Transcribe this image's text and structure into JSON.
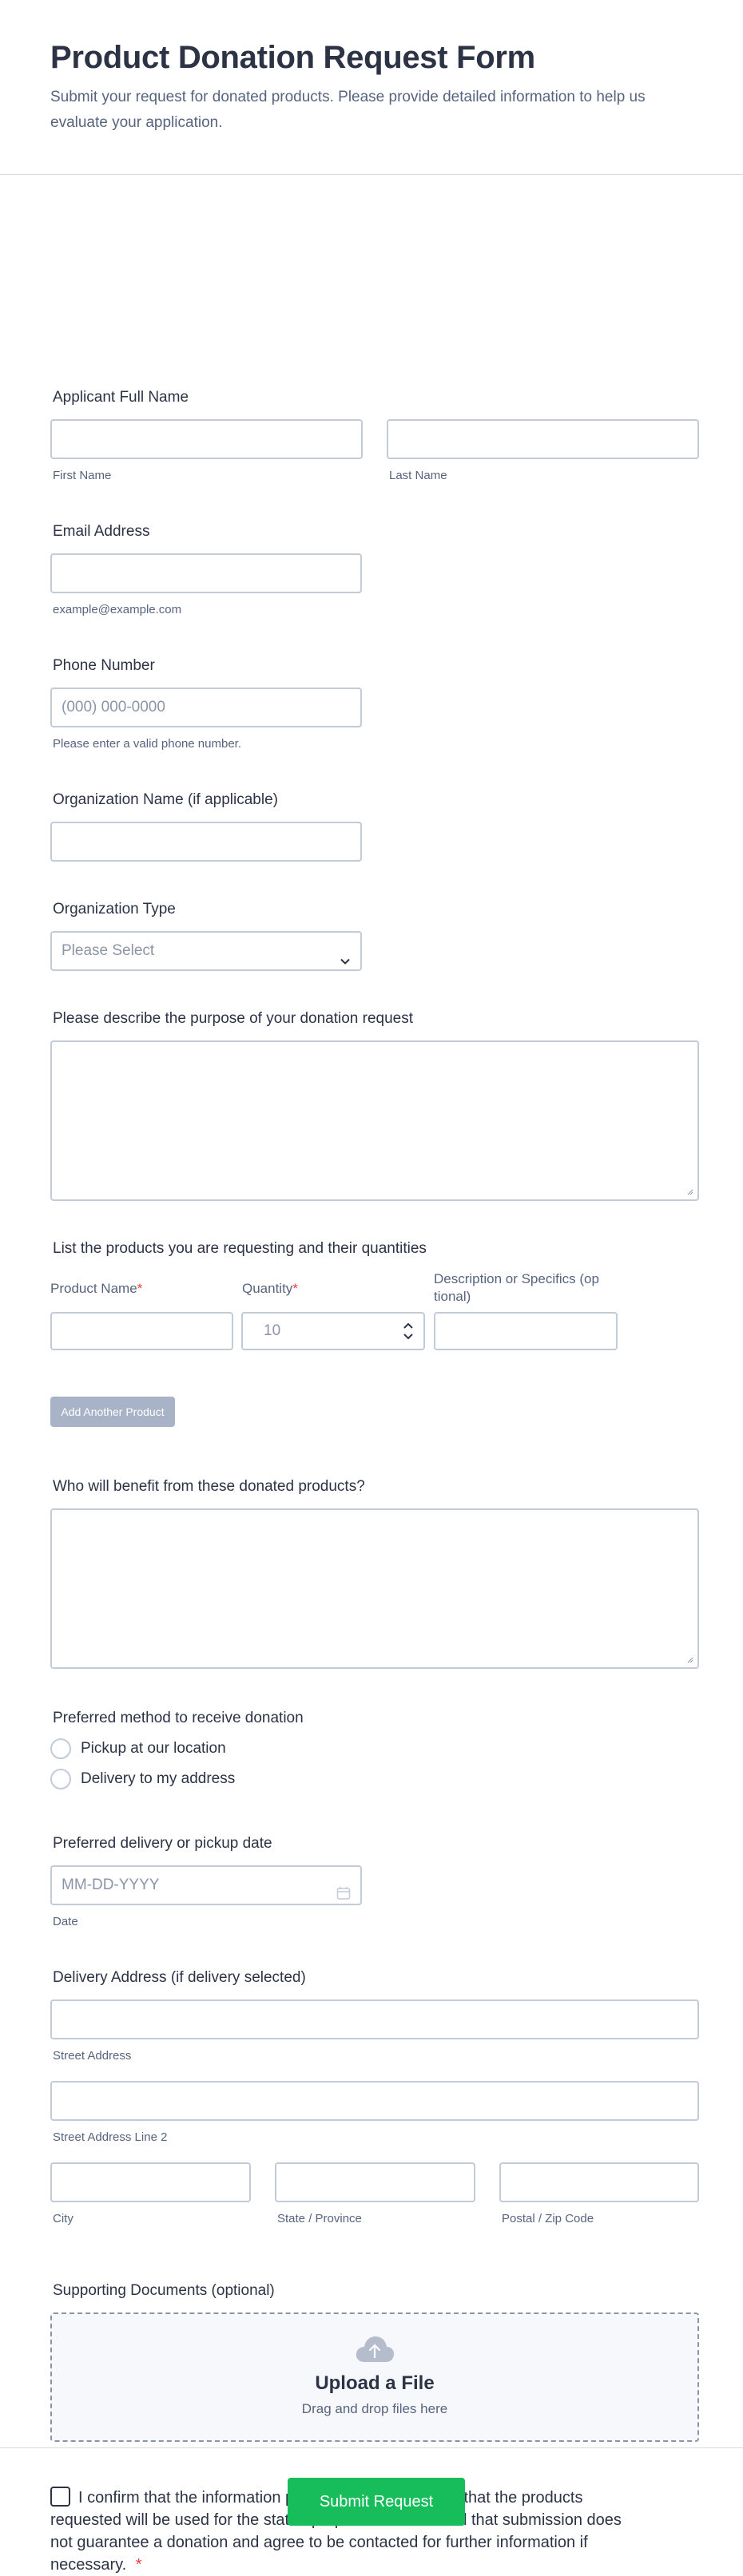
{
  "header": {
    "title": "Product Donation Request Form",
    "subtitle": "Submit your request for donated products. Please provide detailed information to help us evaluate your application."
  },
  "applicant": {
    "label": "Applicant Full Name",
    "first_sub": "First Name",
    "last_sub": "Last Name"
  },
  "email": {
    "label": "Email Address",
    "sub": "example@example.com"
  },
  "phone": {
    "label": "Phone Number",
    "placeholder": "(000) 000-0000",
    "sub": "Please enter a valid phone number."
  },
  "organization": {
    "label": "Organization Name (if applicable)"
  },
  "org_type": {
    "label": "Organization Type",
    "selected": "Please Select"
  },
  "purpose": {
    "label": "Please describe the purpose of your donation request"
  },
  "products": {
    "label": "List the products you are requesting and their quantities",
    "col_name": "Product Name",
    "col_qty": "Quantity",
    "col_desc_line1": "Description or Specifics (op",
    "col_desc_line2": "tional)",
    "qty_placeholder": "10",
    "add_button": "Add Another Product",
    "required_mark": "*"
  },
  "beneficiaries": {
    "label": "Who will benefit from these donated products?"
  },
  "method": {
    "label": "Preferred method to receive donation",
    "options": [
      "Pickup at our location",
      "Delivery to my address"
    ]
  },
  "date": {
    "label": "Preferred delivery or pickup date",
    "placeholder": "MM-DD-YYYY",
    "sub": "Date"
  },
  "address": {
    "label": "Delivery Address (if delivery selected)",
    "street_sub": "Street Address",
    "street2_sub": "Street Address Line 2",
    "city_sub": "City",
    "state_sub": "State / Province",
    "zip_sub": "Postal / Zip Code"
  },
  "documents": {
    "label": "Supporting Documents (optional)",
    "upload_title": "Upload a File",
    "upload_sub": "Drag and drop files here"
  },
  "consent": {
    "text": "I confirm that the information provided is accurate and that the products requested will be used for the stated purpose. I understand that submission does not guarantee a donation and agree to be contacted for further information if necessary.",
    "required_mark": "*"
  },
  "submit": {
    "label": "Submit Request",
    "color": "#18bd5b"
  },
  "icons": {
    "select": "chevron-down-icon",
    "stepper": "stepper-arrows-icon",
    "date": "calendar-icon",
    "upload": "cloud-upload-icon"
  }
}
